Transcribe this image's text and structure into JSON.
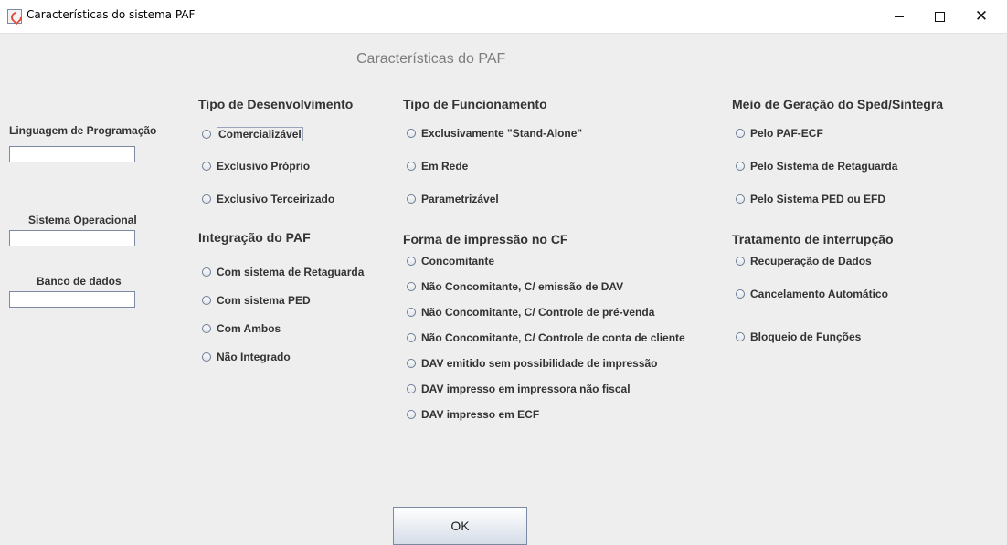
{
  "window": {
    "title": "Características do sistema PAF",
    "minimize_glyph": "",
    "close_glyph": "✕"
  },
  "form_title": "Características do PAF",
  "left_fields": {
    "language_label": "Linguagem de Programação",
    "os_label": "Sistema Operacional",
    "db_label": "Banco de dados",
    "language_value": "",
    "os_value": "",
    "db_value": ""
  },
  "sections": {
    "tipo_desenvolvimento": {
      "title": "Tipo de Desenvolvimento",
      "options": [
        "Comercializável",
        "Exclusivo Próprio",
        "Exclusivo Terceirizado"
      ]
    },
    "integracao": {
      "title": "Integração do PAF",
      "options": [
        "Com sistema de Retaguarda",
        "Com sistema PED",
        "Com Ambos",
        "Não Integrado"
      ]
    },
    "tipo_funcionamento": {
      "title": "Tipo de Funcionamento",
      "options": [
        "Exclusivamente \"Stand-Alone\"",
        "Em Rede",
        "Parametrizável"
      ]
    },
    "forma_impressao": {
      "title": "Forma de impressão no CF",
      "options": [
        "Concomitante",
        "Não Concomitante, C/ emissão de DAV",
        "Não Concomitante, C/ Controle de pré-venda",
        "Não Concomitante, C/ Controle de conta de cliente",
        "DAV emitido sem possibilidade de impressão",
        "DAV impresso em impressora não fiscal",
        "DAV impresso em ECF"
      ]
    },
    "meio_geracao": {
      "title": "Meio de Geração do Sped/Sintegra",
      "options": [
        "Pelo PAF-ECF",
        "Pelo Sistema de Retaguarda",
        "Pelo Sistema PED ou EFD"
      ]
    },
    "tratamento": {
      "title": "Tratamento de interrupção",
      "options": [
        "Recuperação de Dados",
        "Cancelamento Automático",
        "Bloqueio de Funções"
      ]
    }
  },
  "ok_label": "OK"
}
